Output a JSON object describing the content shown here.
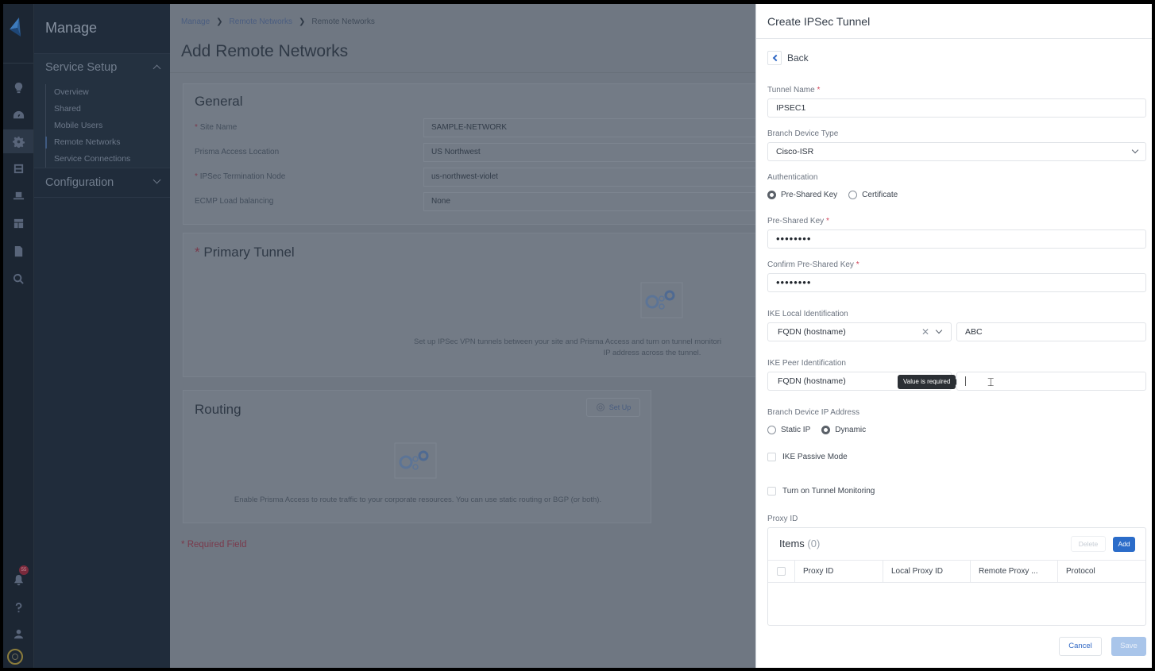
{
  "rail": {
    "icons": [
      "logo-icon",
      "lightbulb-icon",
      "dashboard-icon",
      "gear-icon",
      "panels-icon",
      "laptop-icon",
      "layout-icon",
      "document-icon",
      "search-icon",
      "bell-icon",
      "help-icon",
      "user-icon",
      "settings-ring-icon"
    ],
    "notification_count": "55"
  },
  "nav": {
    "title": "Manage",
    "sections": [
      {
        "label": "Service Setup",
        "expanded": true,
        "items": [
          {
            "label": "Overview",
            "active": false
          },
          {
            "label": "Shared",
            "active": false
          },
          {
            "label": "Mobile Users",
            "active": false
          },
          {
            "label": "Remote Networks",
            "active": true
          },
          {
            "label": "Service Connections",
            "active": false
          }
        ]
      },
      {
        "label": "Configuration",
        "expanded": false
      }
    ]
  },
  "main": {
    "breadcrumb": [
      "Manage",
      "Remote Networks",
      "Remote Networks"
    ],
    "title": "Add Remote Networks",
    "general": {
      "title": "General",
      "fields": [
        {
          "label": "Site Name",
          "required": true,
          "value": "SAMPLE-NETWORK"
        },
        {
          "label": "Prisma Access Location",
          "required": false,
          "value": "US Northwest"
        },
        {
          "label": "IPSec Termination Node",
          "required": true,
          "value": "us-northwest-violet"
        },
        {
          "label": "ECMP Load balancing",
          "required": false,
          "value": "None"
        }
      ]
    },
    "primary_tunnel": {
      "title": "Primary Tunnel",
      "required": true,
      "empty_text_line1": "Set up IPSec VPN tunnels between your site and Prisma Access and turn on tunnel monitori",
      "empty_text_line2": "IP address across the tunnel."
    },
    "routing": {
      "title": "Routing",
      "setup_label": "Set Up",
      "empty_text": "Enable Prisma Access to route traffic to your corporate resources. You can use static routing or BGP (or both)."
    },
    "required_note": "Required Field",
    "required_marker": "*"
  },
  "panel": {
    "title": "Create IPSec Tunnel",
    "back_label": "Back",
    "tunnel_name": {
      "label": "Tunnel Name",
      "value": "IPSEC1",
      "required": true
    },
    "branch_device_type": {
      "label": "Branch Device Type",
      "value": "Cisco-ISR"
    },
    "authentication": {
      "label": "Authentication",
      "options": [
        {
          "label": "Pre-Shared Key",
          "selected": true
        },
        {
          "label": "Certificate",
          "selected": false
        }
      ]
    },
    "psk": {
      "label": "Pre-Shared Key",
      "value": "••••••••",
      "required": true
    },
    "confirm_psk": {
      "label": "Confirm Pre-Shared Key",
      "value": "••••••••",
      "required": true
    },
    "ike_local": {
      "label": "IKE Local Identification",
      "type": "FQDN (hostname)",
      "value": "ABC"
    },
    "ike_peer": {
      "label": "IKE Peer Identification",
      "type": "FQDN (hostname)",
      "value": "",
      "tooltip": "Value is required"
    },
    "branch_ip": {
      "label": "Branch Device IP Address",
      "options": [
        {
          "label": "Static IP",
          "selected": false
        },
        {
          "label": "Dynamic",
          "selected": true
        }
      ]
    },
    "ike_passive": {
      "label": "IKE Passive Mode",
      "checked": false
    },
    "tunnel_monitoring": {
      "label": "Turn on Tunnel Monitoring",
      "checked": false
    },
    "proxy": {
      "label": "Proxy ID",
      "items_title": "Items",
      "items_count": "(0)",
      "delete_label": "Delete",
      "add_label": "Add",
      "columns": [
        "Proxy ID",
        "Local Proxy ID",
        "Remote Proxy ...",
        "Protocol"
      ],
      "rows": []
    },
    "cancel_label": "Cancel",
    "save_label": "Save",
    "accent": "#2b6cc9"
  }
}
